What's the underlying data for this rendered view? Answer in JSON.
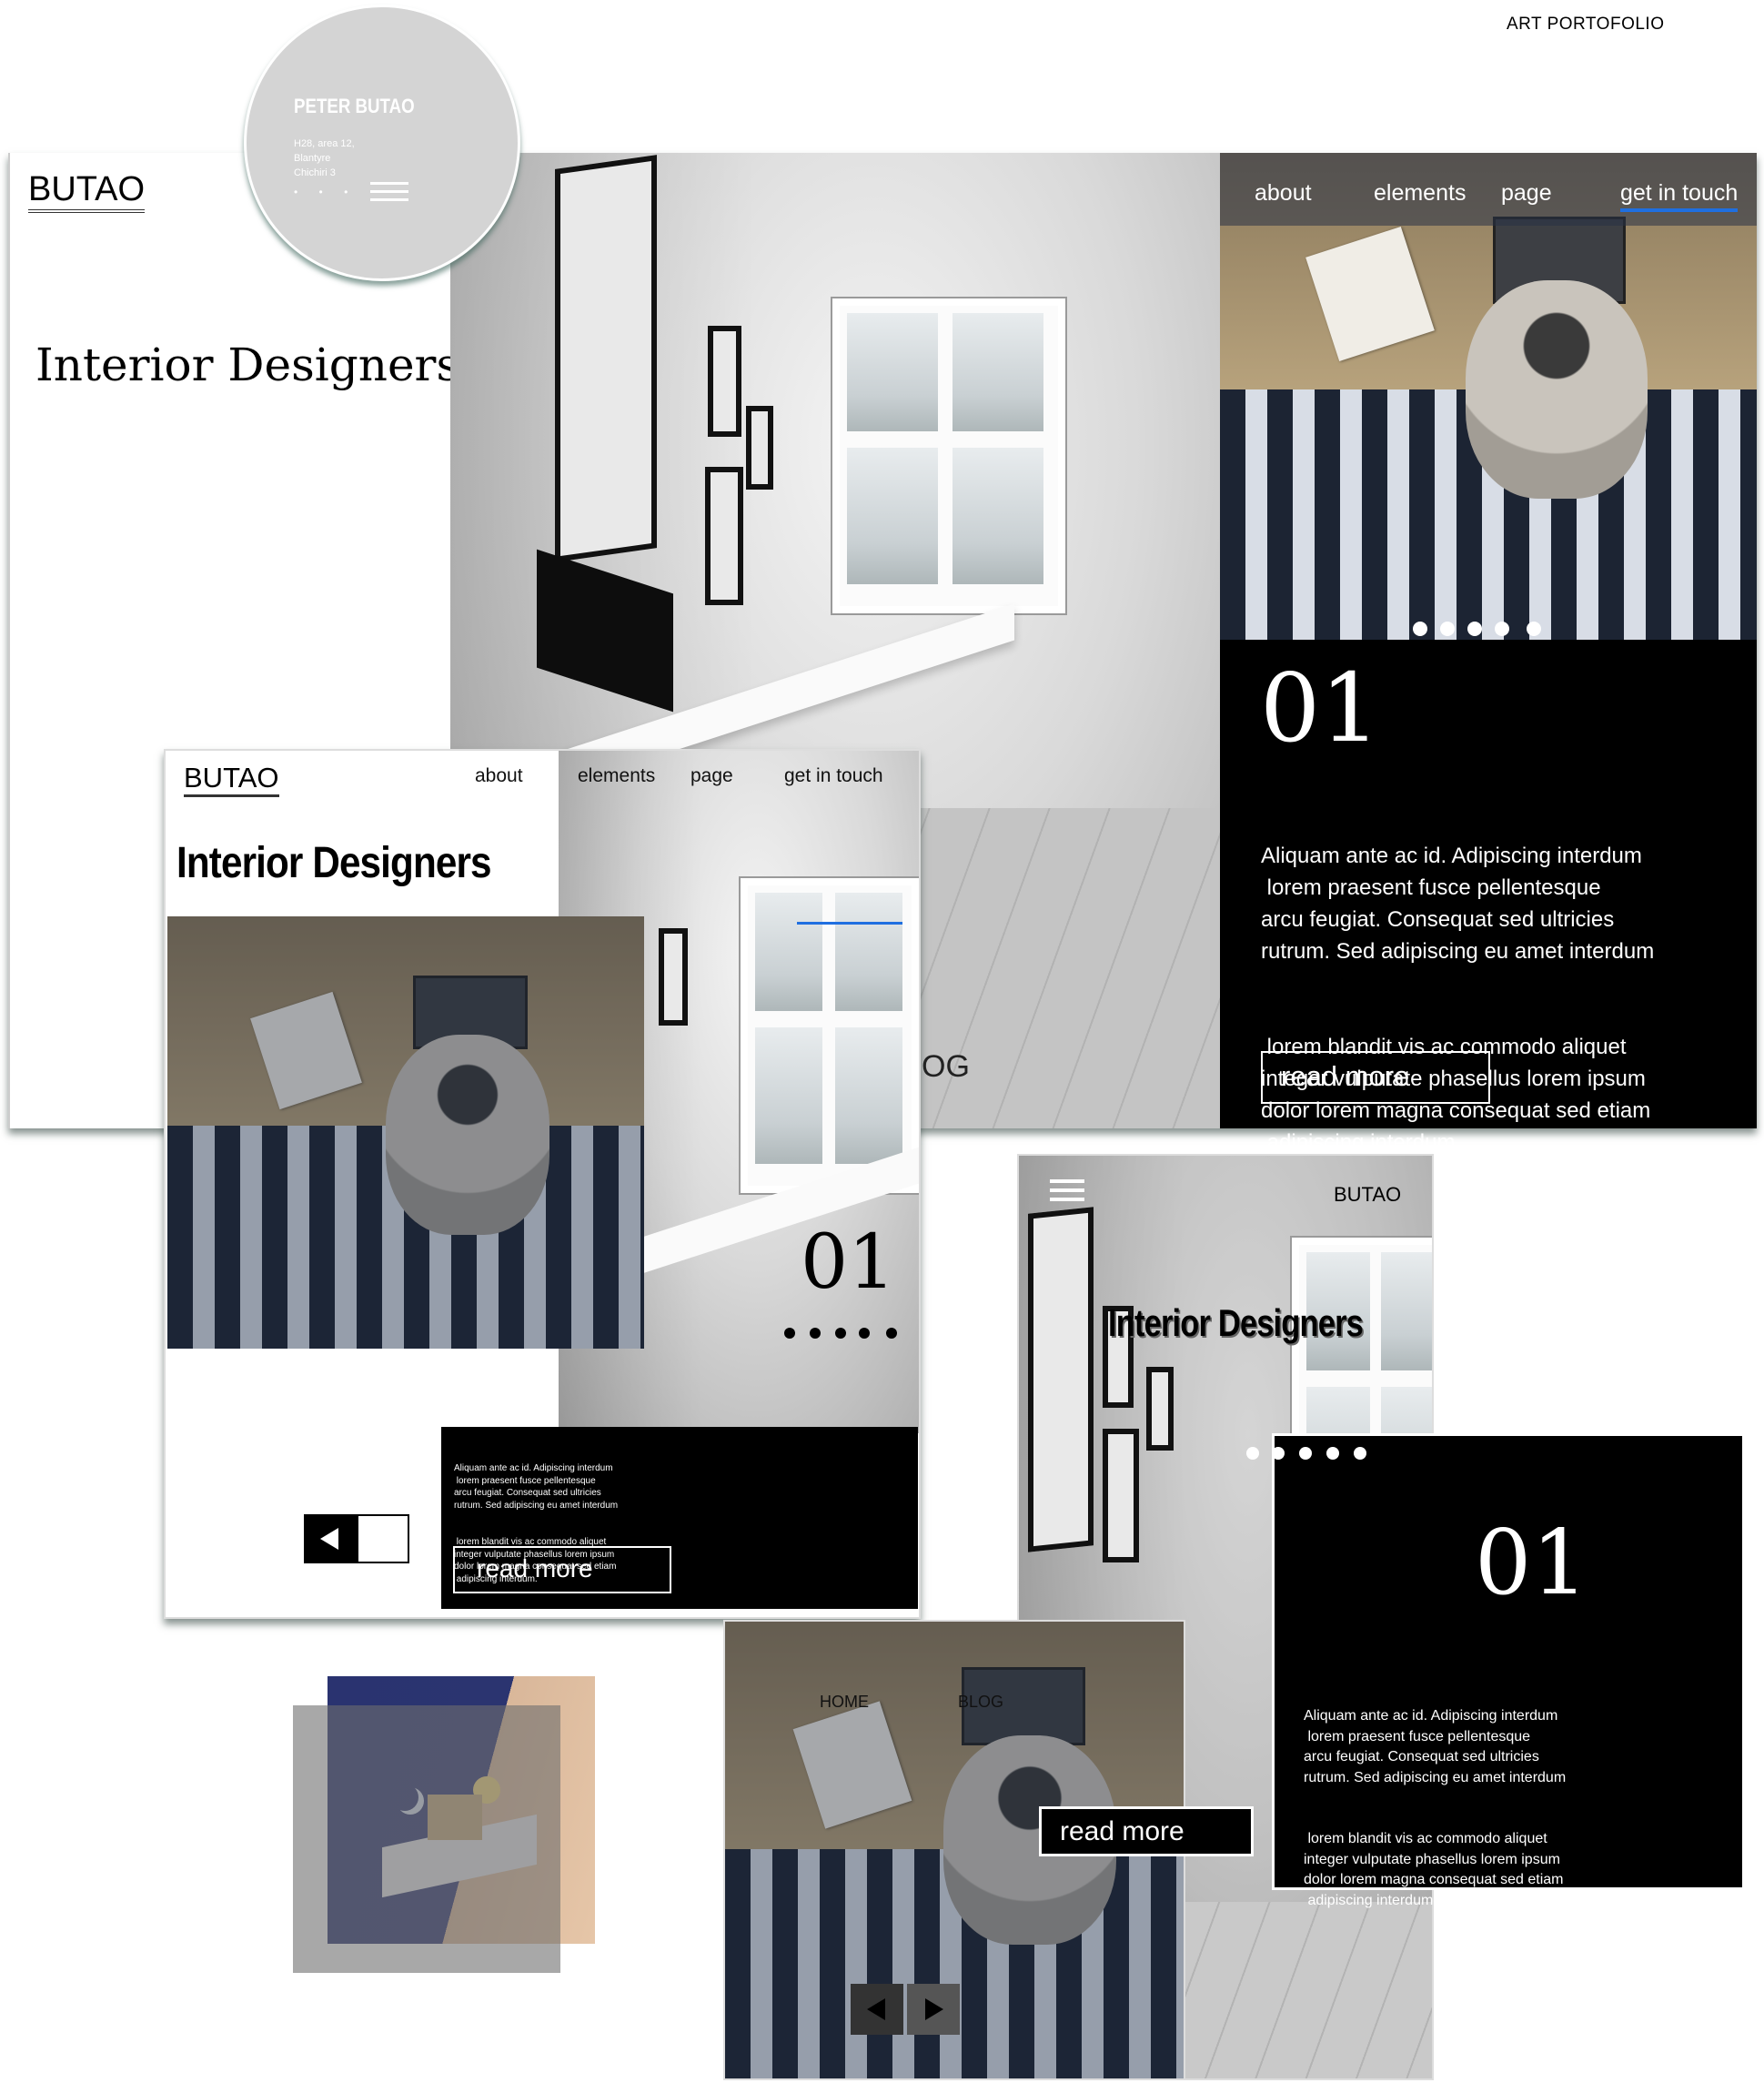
{
  "header": {
    "title": "ART PORTOFOLIO"
  },
  "card": {
    "name": "PETER BUTAO",
    "address_lines": [
      "H28, area 12,",
      "Blantyre",
      "Chichiri 3"
    ],
    "menu_dots": "• • •"
  },
  "desktop": {
    "logo": "BUTAO",
    "heading": "Interior Designers",
    "nav": [
      "about",
      "elements",
      "page",
      "get in touch"
    ],
    "slide_number": "01",
    "body": [
      "Aliquam ante ac id. Adipiscing interdum",
      " lorem praesent fusce pellentesque",
      "arcu feugiat. Consequat sed ultricies",
      "rutrum. Sed adipiscing eu amet interdum",
      " lorem blandit vis ac commodo aliquet",
      "integer vulputate phasellus lorem ipsum",
      "dolor lorem magna consequat sed etiam",
      " adipiscing interdum."
    ],
    "cta": "read more",
    "partial_text": "OG"
  },
  "tablet": {
    "logo": "BUTAO",
    "heading": "Interior Designers",
    "nav": [
      "about",
      "elements",
      "page",
      "get in touch"
    ],
    "slide_number": "01",
    "body": [
      "Aliquam ante ac id. Adipiscing interdum",
      " lorem praesent fusce pellentesque",
      "arcu feugiat. Consequat sed ultricies",
      "rutrum. Sed adipiscing eu amet interdum",
      " lorem blandit vis ac commodo aliquet",
      "integer vulputate phasellus lorem ipsum",
      "dolor lorem magna consequat sed etiam",
      " adipiscing interdum."
    ],
    "cta": "read more"
  },
  "mobile": {
    "logo": "BUTAO",
    "heading": "Interior Designers",
    "slide_number": "01",
    "body": [
      "Aliquam ante ac id. Adipiscing interdum",
      " lorem praesent fusce pellentesque",
      "arcu feugiat. Consequat sed ultricies",
      "rutrum. Sed adipiscing eu amet interdum",
      " lorem blandit vis ac commodo aliquet",
      "integer vulputate phasellus lorem ipsum",
      "dolor lorem magna consequat sed etiam",
      " adipiscing interdum."
    ],
    "cta": "read more",
    "home_label": "HOME",
    "blog_label": "BLOG"
  },
  "colors": {
    "accent_blue": "#1f6fe0",
    "black": "#000000",
    "card_gray": "#d4d4d4"
  },
  "icons": [
    "hamburger-menu-icon",
    "arrow-left-icon",
    "arrow-right-icon",
    "slider-dots"
  ]
}
